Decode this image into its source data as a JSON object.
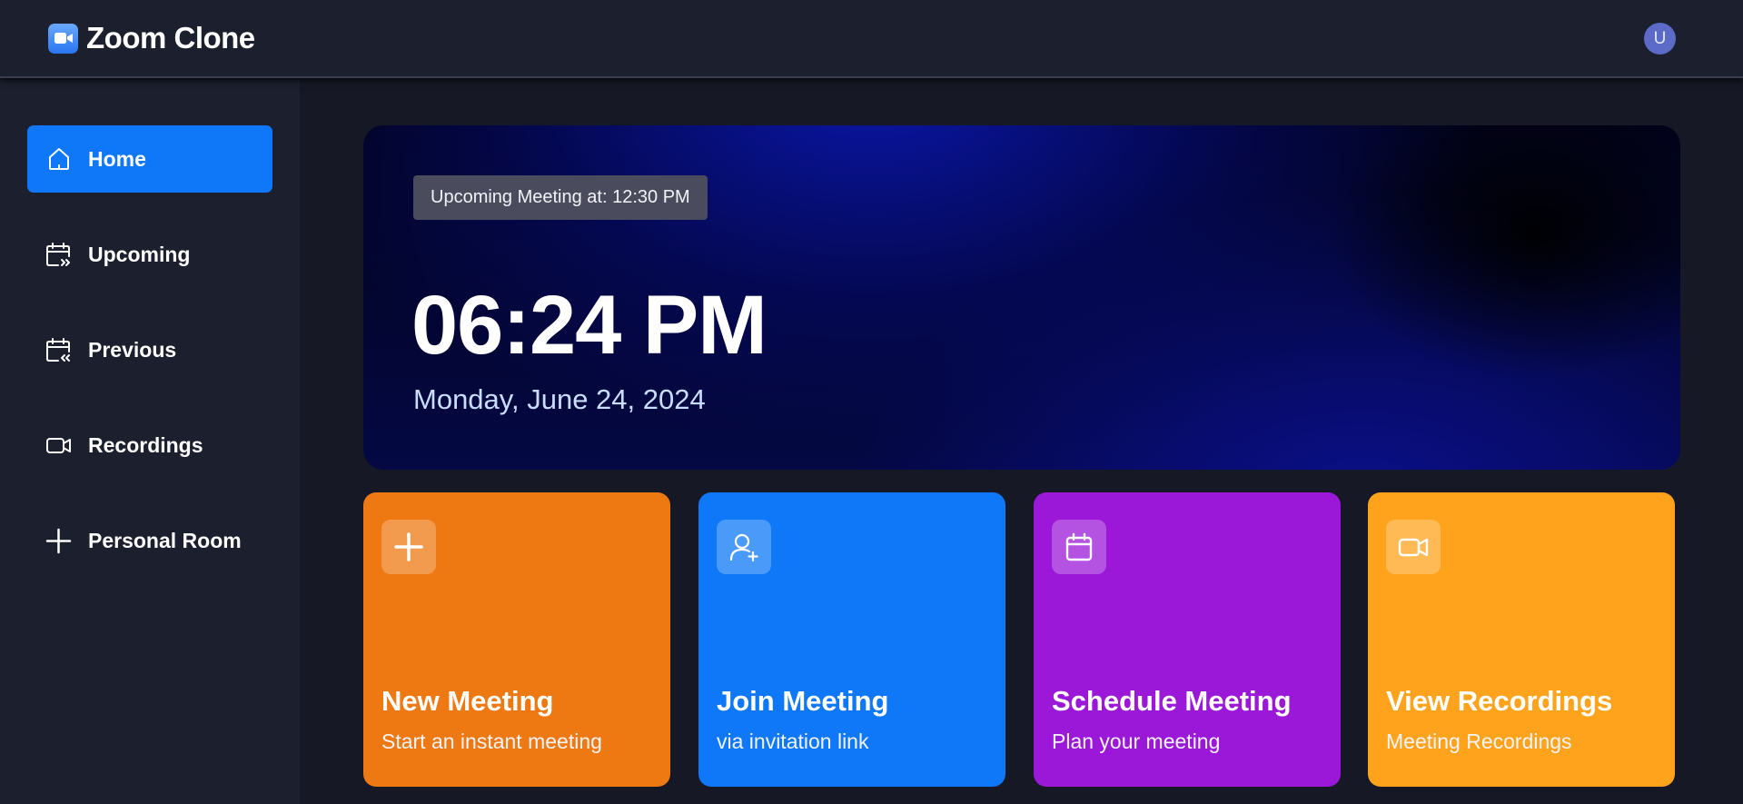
{
  "header": {
    "brand_name": "Zoom Clone",
    "avatar_initial": "U"
  },
  "sidebar": {
    "items": [
      {
        "label": "Home",
        "icon": "home-icon",
        "active": true
      },
      {
        "label": "Upcoming",
        "icon": "calendar-upcoming-icon",
        "active": false
      },
      {
        "label": "Previous",
        "icon": "calendar-previous-icon",
        "active": false
      },
      {
        "label": "Recordings",
        "icon": "video-icon",
        "active": false
      },
      {
        "label": "Personal Room",
        "icon": "plus-icon",
        "active": false
      }
    ]
  },
  "hero": {
    "upcoming_label": "Upcoming Meeting at: 12:30 PM",
    "time": "06:24 PM",
    "date": "Monday, June 24, 2024"
  },
  "cards": [
    {
      "title": "New Meeting",
      "subtitle": "Start an instant meeting",
      "icon": "plus-icon",
      "color": "#ee7812"
    },
    {
      "title": "Join Meeting",
      "subtitle": "via invitation link",
      "icon": "user-plus-icon",
      "color": "#0e78f9"
    },
    {
      "title": "Schedule Meeting",
      "subtitle": "Plan your meeting",
      "icon": "calendar-icon",
      "color": "#9b18d8"
    },
    {
      "title": "View Recordings",
      "subtitle": "Meeting Recordings",
      "icon": "video-icon",
      "color": "#ffa31c"
    }
  ],
  "colors": {
    "background": "#161925",
    "panel": "#1c1f2e",
    "accent": "#0e78f9",
    "badge": "#4a4c5e",
    "avatar": "#5b6bc7"
  }
}
